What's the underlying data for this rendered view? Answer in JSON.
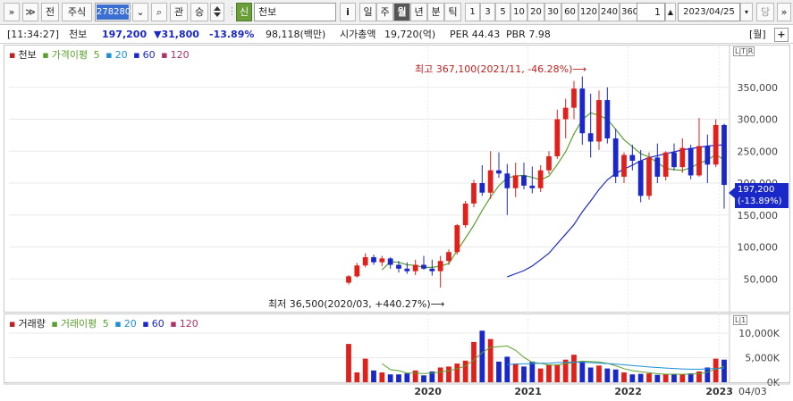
{
  "toolbar": {
    "expand_label": "»",
    "collapse_label": "≫",
    "all_label": "전",
    "market_label": "주식",
    "code_value": "278280",
    "down_arrow": "⌄",
    "search_glyph": "⌕",
    "watch_label": "관",
    "compare_label": "승",
    "credit_label": "신",
    "stock_name": "천보",
    "info_label": "i",
    "periods": [
      "일",
      "주",
      "월",
      "년",
      "분",
      "틱"
    ],
    "active_period": "월",
    "intervals": [
      "1",
      "3",
      "5",
      "10",
      "20",
      "30",
      "60",
      "120",
      "240",
      "360"
    ],
    "count_value": "1",
    "date_value": "2023/04/25",
    "pull_label": "당",
    "more_label": "»"
  },
  "info": {
    "time": "[11:34:27]",
    "name": "천보",
    "price": "197,200",
    "change": "▼31,800",
    "change_pct": "-13.89%",
    "volume": "98,118(백만)",
    "market_cap_label": "시가총액",
    "market_cap": "19,720(억)",
    "per": "PER 44.43",
    "pbr": "PBR 7.98",
    "period_tag": "[월]",
    "zoom_icon": "+"
  },
  "price_legend": {
    "name": "천보",
    "ma_label": "가격이평",
    "ma_periods": [
      "5",
      "20",
      "60",
      "120"
    ]
  },
  "volume_legend": {
    "name": "거래량",
    "ma_label": "거래이평",
    "ma_periods": [
      "5",
      "20",
      "60",
      "120"
    ]
  },
  "badges": {
    "price_box": "L|T|R",
    "volume_box": "L|1"
  },
  "annotations": {
    "high": "최고 367,100(2021/11, -46.28%)",
    "low": "최저 36,500(2020/03, +440.27%)"
  },
  "price_tag": {
    "price": "197,200",
    "pct": "(-13.89%)"
  },
  "x_footer": "04/03",
  "colors": {
    "up": "#e0201b",
    "down": "#1a28c8",
    "ma5": "#5aa02c",
    "ma20": "#1b8fd6",
    "ma60": "#1a28c8",
    "ma120": "#b0306a"
  },
  "chart_data": [
    {
      "type": "candlestick",
      "title": "",
      "y_axis_ticks": [
        "50,000",
        "100,000",
        "150,000",
        "200,000",
        "250,000",
        "300,000",
        "350,000"
      ],
      "x_axis_ticks": [
        "2020",
        "2021",
        "2022",
        "2023"
      ],
      "ylim": [
        0,
        400000
      ],
      "series": [
        {
          "name": "천보",
          "candles": [
            [
              44000,
              56000,
              41000,
              54000
            ],
            [
              54000,
              75000,
              52000,
              71000
            ],
            [
              71000,
              90000,
              68000,
              84000
            ],
            [
              84000,
              88000,
              72000,
              76000
            ],
            [
              76000,
              86000,
              70000,
              82000
            ],
            [
              82000,
              84000,
              66000,
              72000
            ],
            [
              72000,
              78000,
              60000,
              66000
            ],
            [
              66000,
              76000,
              58000,
              62000
            ],
            [
              62000,
              80000,
              56000,
              72000
            ],
            [
              72000,
              86000,
              64000,
              66000
            ],
            [
              66000,
              80000,
              55000,
              62000
            ],
            [
              62000,
              86000,
              36500,
              78000
            ],
            [
              78000,
              96000,
              72000,
              92000
            ],
            [
              92000,
              136000,
              88000,
              134000
            ],
            [
              134000,
              172000,
              130000,
              168000
            ],
            [
              168000,
              205000,
              162000,
              200000
            ],
            [
              200000,
              228000,
              180000,
              185000
            ],
            [
              185000,
              250000,
              175000,
              220000
            ],
            [
              220000,
              248000,
              208000,
              215000
            ],
            [
              215000,
              230000,
              150000,
              192000
            ],
            [
              192000,
              232000,
              178000,
              212000
            ],
            [
              212000,
              232000,
              190000,
              196000
            ],
            [
              196000,
              226000,
              184000,
              192000
            ],
            [
              192000,
              228000,
              186000,
              220000
            ],
            [
              220000,
              250000,
              214000,
              242000
            ],
            [
              242000,
              315000,
              238000,
              300000
            ],
            [
              300000,
              332000,
              270000,
              318000
            ],
            [
              318000,
              360000,
              300000,
              348000
            ],
            [
              348000,
              367100,
              260000,
              278000
            ],
            [
              278000,
              340000,
              240000,
              265000
            ],
            [
              265000,
              345000,
              252000,
              330000
            ],
            [
              330000,
              350000,
              262000,
              270000
            ],
            [
              270000,
              285000,
              200000,
              210000
            ],
            [
              210000,
              248000,
              200000,
              244000
            ],
            [
              244000,
              260000,
              220000,
              235000
            ],
            [
              235000,
              252000,
              170000,
              180000
            ],
            [
              180000,
              248000,
              174000,
              240000
            ],
            [
              240000,
              262000,
              200000,
              210000
            ],
            [
              210000,
              250000,
              204000,
              248000
            ],
            [
              248000,
              262000,
              220000,
              225000
            ],
            [
              225000,
              270000,
              216000,
              255000
            ],
            [
              255000,
              260000,
              206000,
              212000
            ],
            [
              212000,
              302000,
              210000,
              258000
            ],
            [
              258000,
              276000,
              200000,
              229000
            ],
            [
              229000,
              300000,
              225000,
              291000
            ],
            [
              291000,
              293000,
              160000,
              197200
            ]
          ]
        },
        {
          "name": "5",
          "values": [
            null,
            null,
            null,
            null,
            64000,
            77000,
            76000,
            72000,
            71000,
            68000,
            68000,
            70000,
            74000,
            94000,
            114000,
            134000,
            157000,
            178000,
            196000,
            208000,
            211000,
            212000,
            209000,
            205000,
            211000,
            229000,
            249000,
            277000,
            299000,
            310000,
            306000,
            300000,
            284000,
            268000,
            257000,
            246000,
            241000,
            232000,
            223000,
            221000,
            220000,
            224000,
            231000,
            236000,
            245000,
            236000
          ]
        },
        {
          "name": "20",
          "values": [
            null,
            null,
            null,
            null,
            null,
            null,
            null,
            null,
            null,
            null,
            null,
            null,
            null,
            null,
            null,
            null,
            null,
            null,
            null,
            null,
            null,
            null,
            null,
            null,
            null,
            null,
            null,
            null,
            null,
            null,
            null,
            null,
            null,
            null,
            null,
            null,
            null,
            null,
            null,
            null,
            null,
            null,
            null,
            null,
            null,
            null
          ]
        },
        {
          "name": "60",
          "values": [
            null,
            null,
            null,
            null,
            null,
            null,
            null,
            null,
            null,
            null,
            null,
            null,
            null,
            null,
            null,
            null,
            null,
            null,
            null,
            53000,
            58000,
            63000,
            70000,
            80000,
            90000,
            105000,
            120000,
            135000,
            155000,
            172000,
            190000,
            205000,
            215000,
            222000,
            228000,
            235000,
            240000,
            243000,
            246000,
            249000,
            252000,
            254000,
            256000,
            258000,
            259000,
            260000
          ]
        }
      ]
    },
    {
      "type": "bar",
      "title": "",
      "y_axis_ticks": [
        "0K",
        "5,000K",
        "10,000K"
      ],
      "ylim": [
        0,
        12000000
      ],
      "series": [
        {
          "name": "거래량",
          "values": [
            7800000,
            2000000,
            4800000,
            2400000,
            2000000,
            1600000,
            1600000,
            1800000,
            2400000,
            1400000,
            2200000,
            3000000,
            3200000,
            3800000,
            4400000,
            8200000,
            10500000,
            8800000,
            4200000,
            5200000,
            3800000,
            3200000,
            4200000,
            2800000,
            3600000,
            3600000,
            4600000,
            5600000,
            4300000,
            3000000,
            3400000,
            2800000,
            2600000,
            2000000,
            1600000,
            1700000,
            1800000,
            1500000,
            1600000,
            1600000,
            1600000,
            1800000,
            2200000,
            3000000,
            4800000,
            4600000
          ]
        },
        {
          "name": "거래이평 5",
          "values": [
            null,
            null,
            null,
            null,
            3800000,
            2560000,
            2360000,
            1880000,
            1880000,
            1760000,
            1880000,
            2080000,
            2360000,
            2720000,
            3320000,
            4520000,
            6020000,
            7140000,
            7260000,
            7380000,
            6500000,
            5080000,
            4040000,
            3840000,
            3520000,
            3480000,
            3760000,
            4040000,
            4300000,
            4200000,
            4140000,
            3840000,
            3360000,
            2760000,
            2360000,
            2140000,
            1940000,
            1720000,
            1640000,
            1640000,
            1620000,
            1660000,
            1740000,
            2040000,
            2680000,
            3240000
          ]
        },
        {
          "name": "거래이평 20",
          "values": [
            null,
            null,
            null,
            null,
            null,
            null,
            null,
            null,
            null,
            null,
            null,
            null,
            null,
            null,
            null,
            null,
            null,
            null,
            null,
            3600000,
            3700000,
            3750000,
            3800000,
            3850000,
            3900000,
            4000000,
            4050000,
            4100000,
            4050000,
            4000000,
            3900000,
            3800000,
            3700000,
            3550000,
            3400000,
            3250000,
            3100000,
            3000000,
            2900000,
            2800000,
            2700000,
            2650000,
            2650000,
            2700000,
            2800000,
            2900000
          ]
        }
      ]
    }
  ]
}
